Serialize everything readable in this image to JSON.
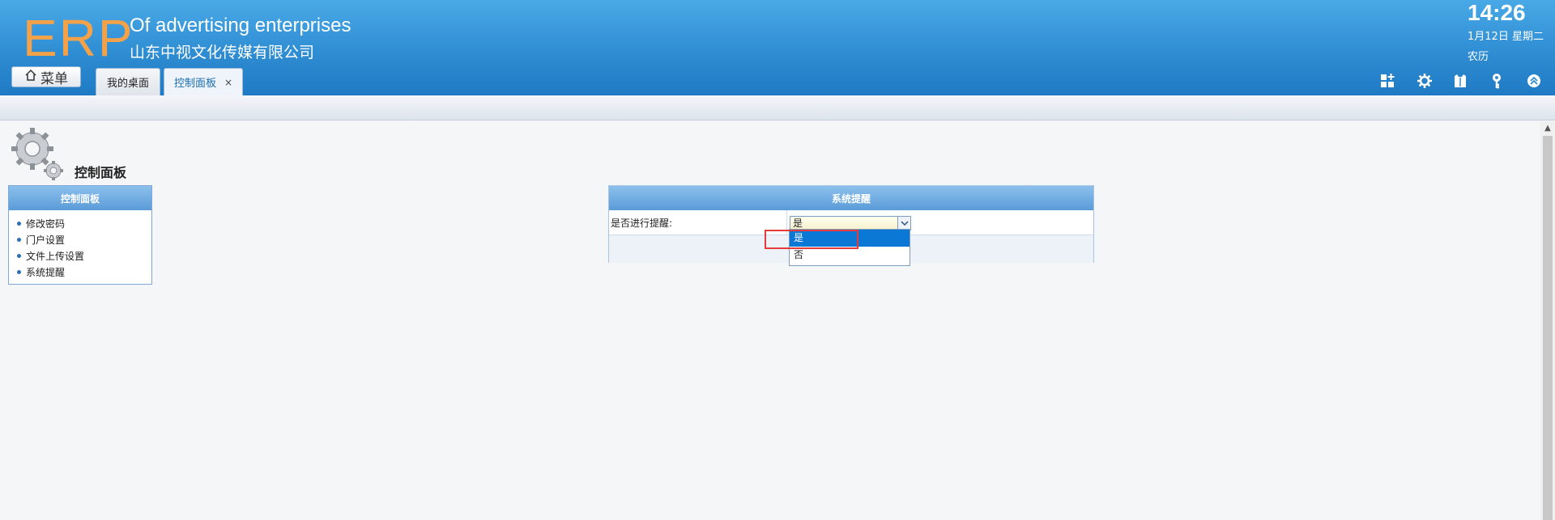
{
  "header": {
    "logo": "ERP",
    "company_en": "Of advertising enterprises",
    "company_cn": "山东中视文化传媒有限公司",
    "time": "14:26",
    "date": "1月12日 星期二",
    "lunar": "农历",
    "icons": [
      "layout-grid-icon",
      "gear-icon",
      "shirt-icon",
      "key-icon",
      "collapse-up-icon"
    ]
  },
  "nav": {
    "menu_label": "菜单",
    "tabs": [
      {
        "label": "我的桌面",
        "active": false
      },
      {
        "label": "控制面板",
        "active": true,
        "close": "×"
      }
    ]
  },
  "page": {
    "title": "控制面板"
  },
  "left_panel": {
    "title": "控制面板",
    "items": [
      "修改密码",
      "门户设置",
      "文件上传设置",
      "系统提醒"
    ]
  },
  "right_panel": {
    "title": "系统提醒",
    "field_label": "是否进行提醒:",
    "select_value": "是",
    "options": [
      "是",
      "否"
    ],
    "highlighted_option": "是"
  },
  "colors": {
    "header_blue": "#2f8dd3",
    "logo_orange": "#f4a24a",
    "selected_option": "#0b78d6",
    "highlight_red": "#e43b3b"
  }
}
